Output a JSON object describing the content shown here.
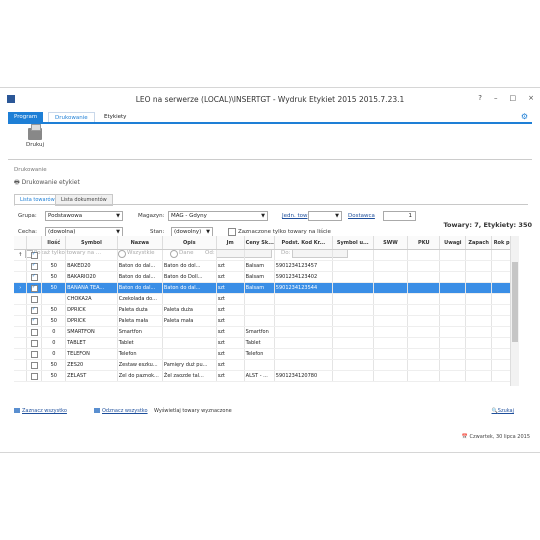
{
  "window": {
    "title": "LEO na serwerze (LOCAL)\\INSERTGT - Wydruk Etykiet 2015 2015.7.23.1",
    "controls": [
      "?",
      "–",
      "□",
      "×"
    ]
  },
  "ribbon": {
    "tabs": [
      "Program",
      "Drukowanie",
      "Etykiety"
    ],
    "print_label": "Drukuj"
  },
  "section": {
    "label": "Drukowanie",
    "sublabel": "Drukowanie etykiet"
  },
  "tabs": [
    "Lista towarów",
    "Lista dokumentów"
  ],
  "filters": {
    "grupa_label": "Grupa:",
    "grupa_value": "Podstawowa",
    "magazyn_label": "Magazyn:",
    "magazyn_value": "MAG - Gdyny",
    "jednostka_link": "Jedn. tow",
    "dostawca_link": "Dostawca",
    "dostawca_value": "1",
    "cecha_label": "Cecha:",
    "cecha_value": "(dowolna)",
    "stan_label": "Stan:",
    "stan_value": "(dowolny)",
    "zaznaczone_label": "Zaznaczone tylko towary na liście",
    "pokaz_label": "Pokaż tylko towary na ...",
    "radio1": "Wszystkie",
    "radio2": "Dane",
    "radio3": "Od:",
    "radio4": "Do:"
  },
  "summary": "Towary: 7, Etykiety: 350",
  "table": {
    "columns": [
      "",
      "",
      "Ilość",
      "Symbol",
      "Nazwa",
      "Opis",
      "Jm",
      "Ceny Sk...",
      "Podst. Kod Kr...",
      "Symbol u...",
      "SWW",
      "PKU",
      "Uwagi",
      "Zapach",
      "Rok p..."
    ],
    "rows": [
      {
        "arrow": "↑",
        "chk": true,
        "ilosc": "",
        "symbol": "",
        "nazwa": "",
        "opis": "",
        "jm": "",
        "ceny": "",
        "kod": "",
        "sel": false
      },
      {
        "arrow": "",
        "chk": true,
        "ilosc": "50",
        "symbol": "BAKED20",
        "nazwa": "Baton do dal...",
        "opis": "Baton do dol...",
        "jm": "szt",
        "ceny": "Balsam",
        "kod": "5901234123457",
        "sel": false
      },
      {
        "arrow": "",
        "chk": true,
        "ilosc": "50",
        "symbol": "BAKARIO20",
        "nazwa": "Baton do dal...",
        "opis": "Baton do Doll...",
        "jm": "szt",
        "ceny": "Balsam",
        "kod": "5901234123402",
        "sel": false
      },
      {
        "arrow": "›",
        "chk": true,
        "ilosc": "50",
        "symbol": "BANANA TEA...",
        "nazwa": "Baton do dal...",
        "opis": "Baton do dal...",
        "jm": "szt",
        "ceny": "Balsam",
        "kod": "5901234123544",
        "sel": true
      },
      {
        "arrow": "",
        "chk": false,
        "ilosc": "",
        "symbol": "CHOKA2A",
        "nazwa": "Czekolada do...",
        "opis": "",
        "jm": "szt",
        "ceny": "",
        "kod": "",
        "sel": false
      },
      {
        "arrow": "",
        "chk": true,
        "ilosc": "50",
        "symbol": "DPRICK",
        "nazwa": "Paleta duża",
        "opis": "Paleta duża",
        "jm": "szt",
        "ceny": "",
        "kod": "",
        "sel": false
      },
      {
        "arrow": "",
        "chk": true,
        "ilosc": "50",
        "symbol": "DPRICK",
        "nazwa": "Paleta mała",
        "opis": "Paleta mała",
        "jm": "szt",
        "ceny": "",
        "kod": "",
        "sel": false
      },
      {
        "arrow": "",
        "chk": false,
        "ilosc": "0",
        "symbol": "SMARTFON",
        "nazwa": "Smartfon",
        "opis": "",
        "jm": "szt",
        "ceny": "Smartfon",
        "kod": "",
        "sel": false
      },
      {
        "arrow": "",
        "chk": false,
        "ilosc": "0",
        "symbol": "TABLET",
        "nazwa": "Tablet",
        "opis": "",
        "jm": "szt",
        "ceny": "Tablet",
        "kod": "",
        "sel": false
      },
      {
        "arrow": "",
        "chk": false,
        "ilosc": "0",
        "symbol": "TELEFON",
        "nazwa": "Telefon",
        "opis": "",
        "jm": "szt",
        "ceny": "Telefon",
        "kod": "",
        "sel": false
      },
      {
        "arrow": "",
        "chk": false,
        "ilosc": "50",
        "symbol": "ZES20",
        "nazwa": "Zestaw eszku...",
        "opis": "Pamięry duż pu...",
        "jm": "szt",
        "ceny": "",
        "kod": "",
        "sel": false
      },
      {
        "arrow": "",
        "chk": false,
        "ilosc": "50",
        "symbol": "ZELAST",
        "nazwa": "Zel do paznok...",
        "opis": "Żel zaozde tal...",
        "jm": "szt",
        "ceny": "ALST - ...",
        "kod": "5901234120780",
        "sel": false
      }
    ]
  },
  "bottom": {
    "link1": "Zaznacz wszystko",
    "link2": "Odznacz wszystko",
    "link3": "Wyświetlaj towary wyznaczone",
    "link4": "Szukaj"
  },
  "status": "Czwartek, 30 lipca 2015",
  "accent": "#1e7fd6"
}
